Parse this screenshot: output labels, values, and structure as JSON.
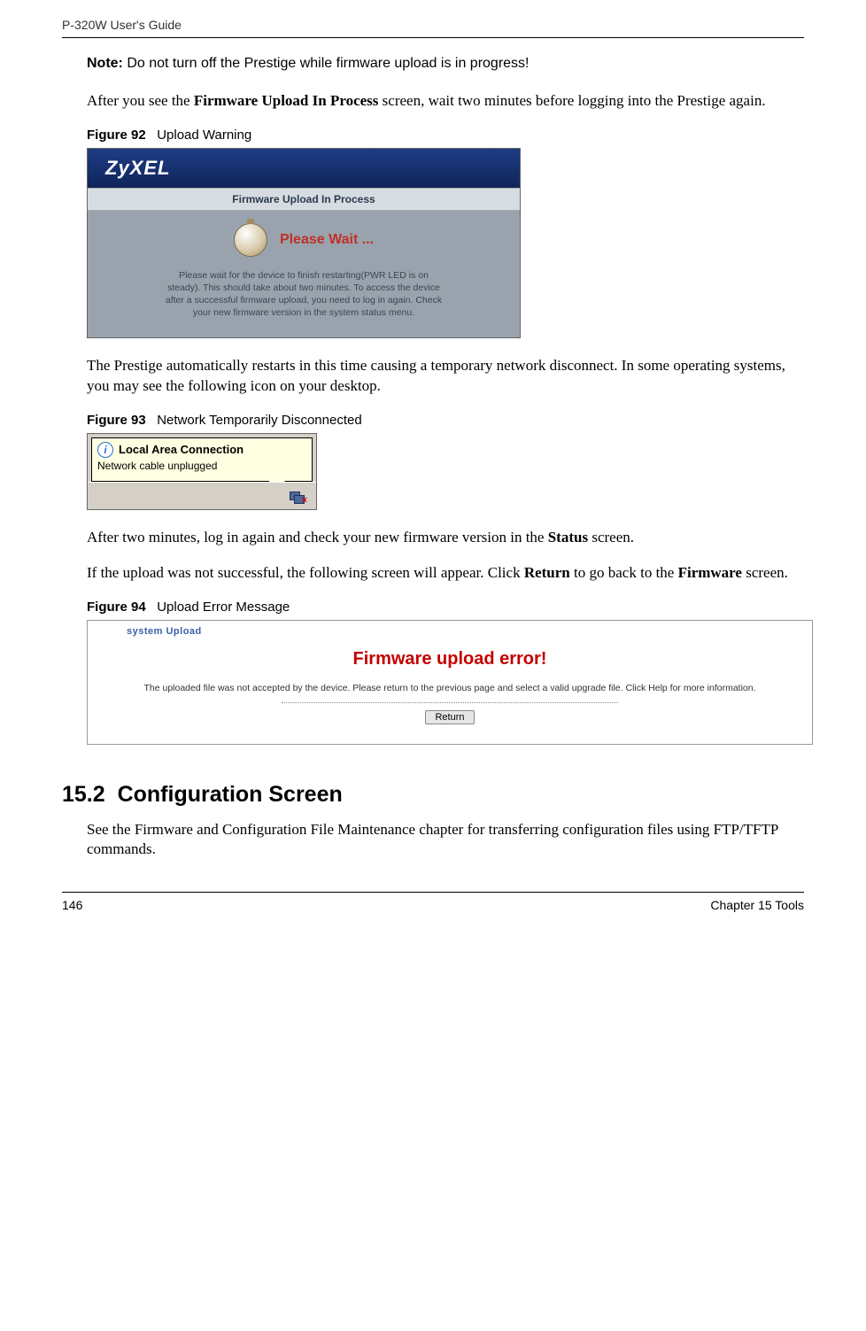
{
  "header": {
    "guide_title": "P-320W User's Guide"
  },
  "note": {
    "label": "Note:",
    "text": "Do not turn off the Prestige while firmware upload is in progress!"
  },
  "para1": {
    "pre": "After you see the ",
    "bold": "Firmware Upload In Process",
    "post": " screen, wait two minutes before logging into the Prestige again."
  },
  "fig92": {
    "label": "Figure 92",
    "caption": "Upload Warning",
    "logo": "ZyXEL",
    "title_bar": "Firmware Upload In Process",
    "please_wait": "Please Wait ...",
    "small_text": "Please wait for the device to finish restarting(PWR LED is on steady). This should take about two minutes. To access the device after a successful firmware upload, you need to log in again. Check your new firmware version in the system status menu."
  },
  "para2": "The Prestige automatically restarts in this time causing a temporary network disconnect. In some operating systems, you may see the following icon on your desktop.",
  "fig93": {
    "label": "Figure 93",
    "caption": "Network Temporarily Disconnected",
    "balloon_title": "Local Area Connection",
    "balloon_text": "Network cable unplugged"
  },
  "para3": {
    "pre": "After two minutes, log in again and check your new firmware version in the ",
    "bold": "Status",
    "post": " screen."
  },
  "para4": {
    "pre": "If the upload was not successful, the following screen will appear. Click ",
    "bold1": "Return",
    "mid": " to go back to the ",
    "bold2": "Firmware",
    "post": " screen."
  },
  "fig94": {
    "label": "Figure 94",
    "caption": "Upload Error Message",
    "panel_label": "system Upload",
    "error_title": "Firmware upload error!",
    "error_text": "The uploaded file was not accepted by the device. Please return to the previous page and select a valid upgrade file. Click Help for more information.",
    "return_button": "Return"
  },
  "section": {
    "number": "15.2",
    "title": "Configuration Screen"
  },
  "para5": "See the Firmware and Configuration File Maintenance chapter for transferring configuration files using FTP/TFTP commands.",
  "footer": {
    "page": "146",
    "chapter": "Chapter 15 Tools"
  }
}
